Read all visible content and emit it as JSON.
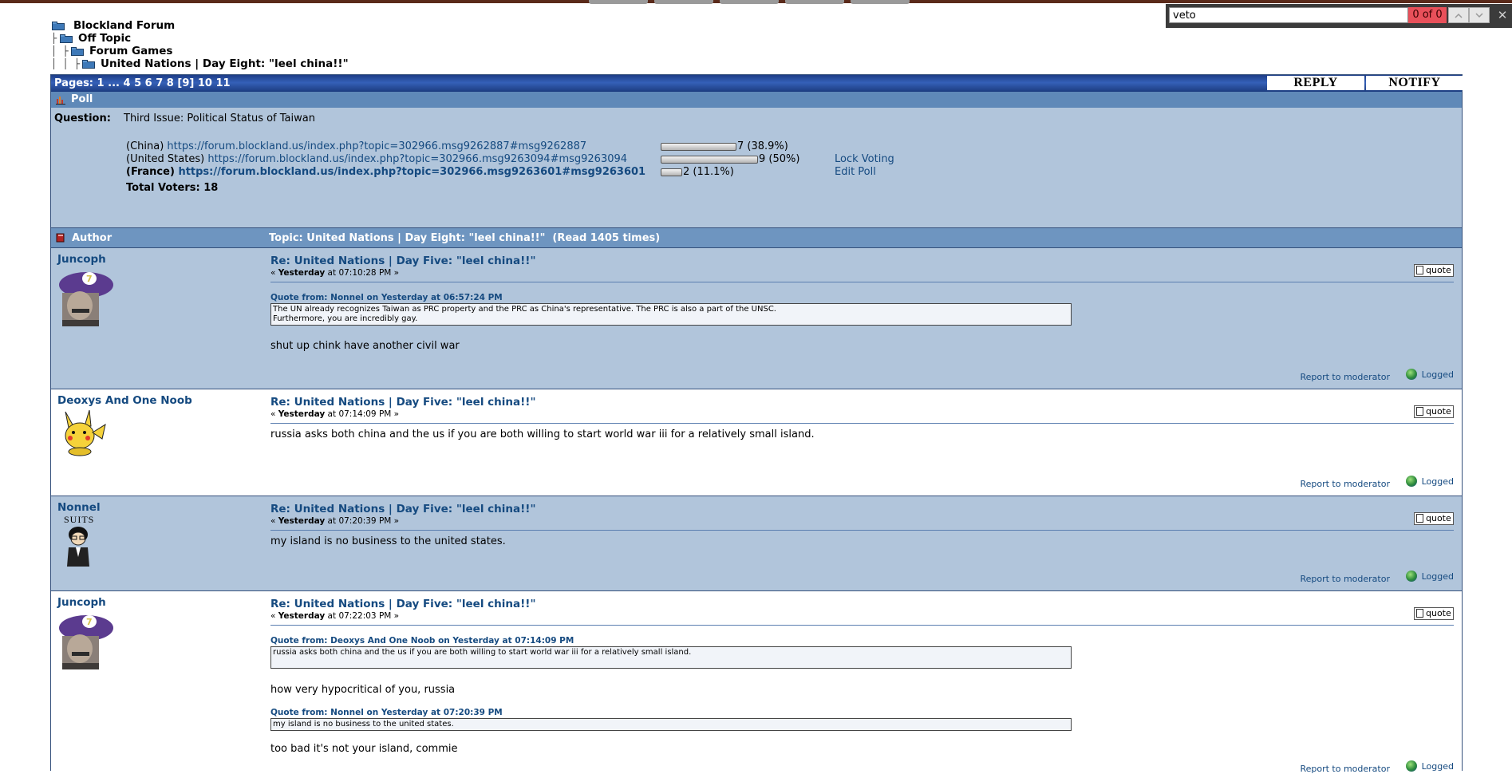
{
  "findbar": {
    "query": "veto",
    "count": "0 of 0",
    "prev_icon": "chevron-up-icon",
    "next_icon": "chevron-down-icon",
    "close_glyph": "✕"
  },
  "breadcrumb": [
    "Blockland Forum",
    "Off Topic",
    "Forum Games",
    "United Nations | Day Eight: \"leel china!!\""
  ],
  "pagination": {
    "label": "Pages:",
    "items": [
      "1",
      "...",
      "4",
      "5",
      "6",
      "7",
      "8",
      "[9]",
      "10",
      "11"
    ]
  },
  "buttons": {
    "reply": "REPLY",
    "notify": "NOTIFY"
  },
  "poll": {
    "title": "Poll",
    "question_label": "Question:",
    "question": "Third Issue: Political Status of Taiwan",
    "options": [
      {
        "prefix": "(China)",
        "link": "https://forum.blockland.us/index.php?topic=302966.msg9262887#msg9262887",
        "votes": 7,
        "percent": 38.9,
        "result": "7 (38.9%)",
        "bold": false
      },
      {
        "prefix": "(United States)",
        "link": "https://forum.blockland.us/index.php?topic=302966.msg9263094#msg9263094",
        "votes": 9,
        "percent": 50,
        "result": "9 (50%)",
        "bold": false
      },
      {
        "prefix": "(France)",
        "link": "https://forum.blockland.us/index.php?topic=302966.msg9263601#msg9263601",
        "votes": 2,
        "percent": 11.1,
        "result": "2 (11.1%)",
        "bold": true
      }
    ],
    "total_voters": "Total Voters: 18",
    "lock_voting": "Lock Voting",
    "edit_poll": "Edit Poll"
  },
  "header": {
    "author": "Author",
    "topic": "Topic: United Nations | Day Eight: \"leel china!!\"  (Read 1405 times)"
  },
  "common": {
    "quote": "quote",
    "report": "Report to moderator",
    "logged": "Logged"
  },
  "posts": [
    {
      "author": "Juncoph",
      "subject": "Re: United Nations | Day Five: \"leel china!!\"",
      "date_prefix": "« ",
      "date_bold": "Yesterday",
      "date_rest": " at 07:10:28 PM »",
      "quote_head": "Quote from: Nonnel on Yesterday at 06:57:24 PM",
      "quote_line1": "The UN already recognizes Taiwan as PRC property and the PRC as China's representative. The PRC is also a part of the UNSC.",
      "quote_line2": "Furthermore, you are incredibly gay.",
      "body": "shut up chink have another civil war"
    },
    {
      "author": "Deoxys And One Noob",
      "subject": "Re: United Nations | Day Five: \"leel china!!\"",
      "date_prefix": "« ",
      "date_bold": "Yesterday",
      "date_rest": " at 07:14:09 PM »",
      "body": "russia asks both china and the us if you are both willing to start world war iii for a relatively small island."
    },
    {
      "author": "Nonnel",
      "avatar_caption": "SUITS",
      "subject": "Re: United Nations | Day Five: \"leel china!!\"",
      "date_prefix": "« ",
      "date_bold": "Yesterday",
      "date_rest": " at 07:20:39 PM »",
      "body": "my island is no business to the united states."
    },
    {
      "author": "Juncoph",
      "subject": "Re: United Nations | Day Five: \"leel china!!\"",
      "date_prefix": "« ",
      "date_bold": "Yesterday",
      "date_rest": " at 07:22:03 PM »",
      "quote1_head": "Quote from: Deoxys And One Noob on Yesterday at 07:14:09 PM",
      "quote1": "russia asks both china and the us if you are both willing to start world war iii for a relatively small island.",
      "body1": "how very hypocritical of you, russia",
      "quote2_head": "Quote from: Nonnel on Yesterday at 07:20:39 PM",
      "quote2": "my island is no business to the united states.",
      "body2": "too bad it's not your island, commie"
    }
  ]
}
